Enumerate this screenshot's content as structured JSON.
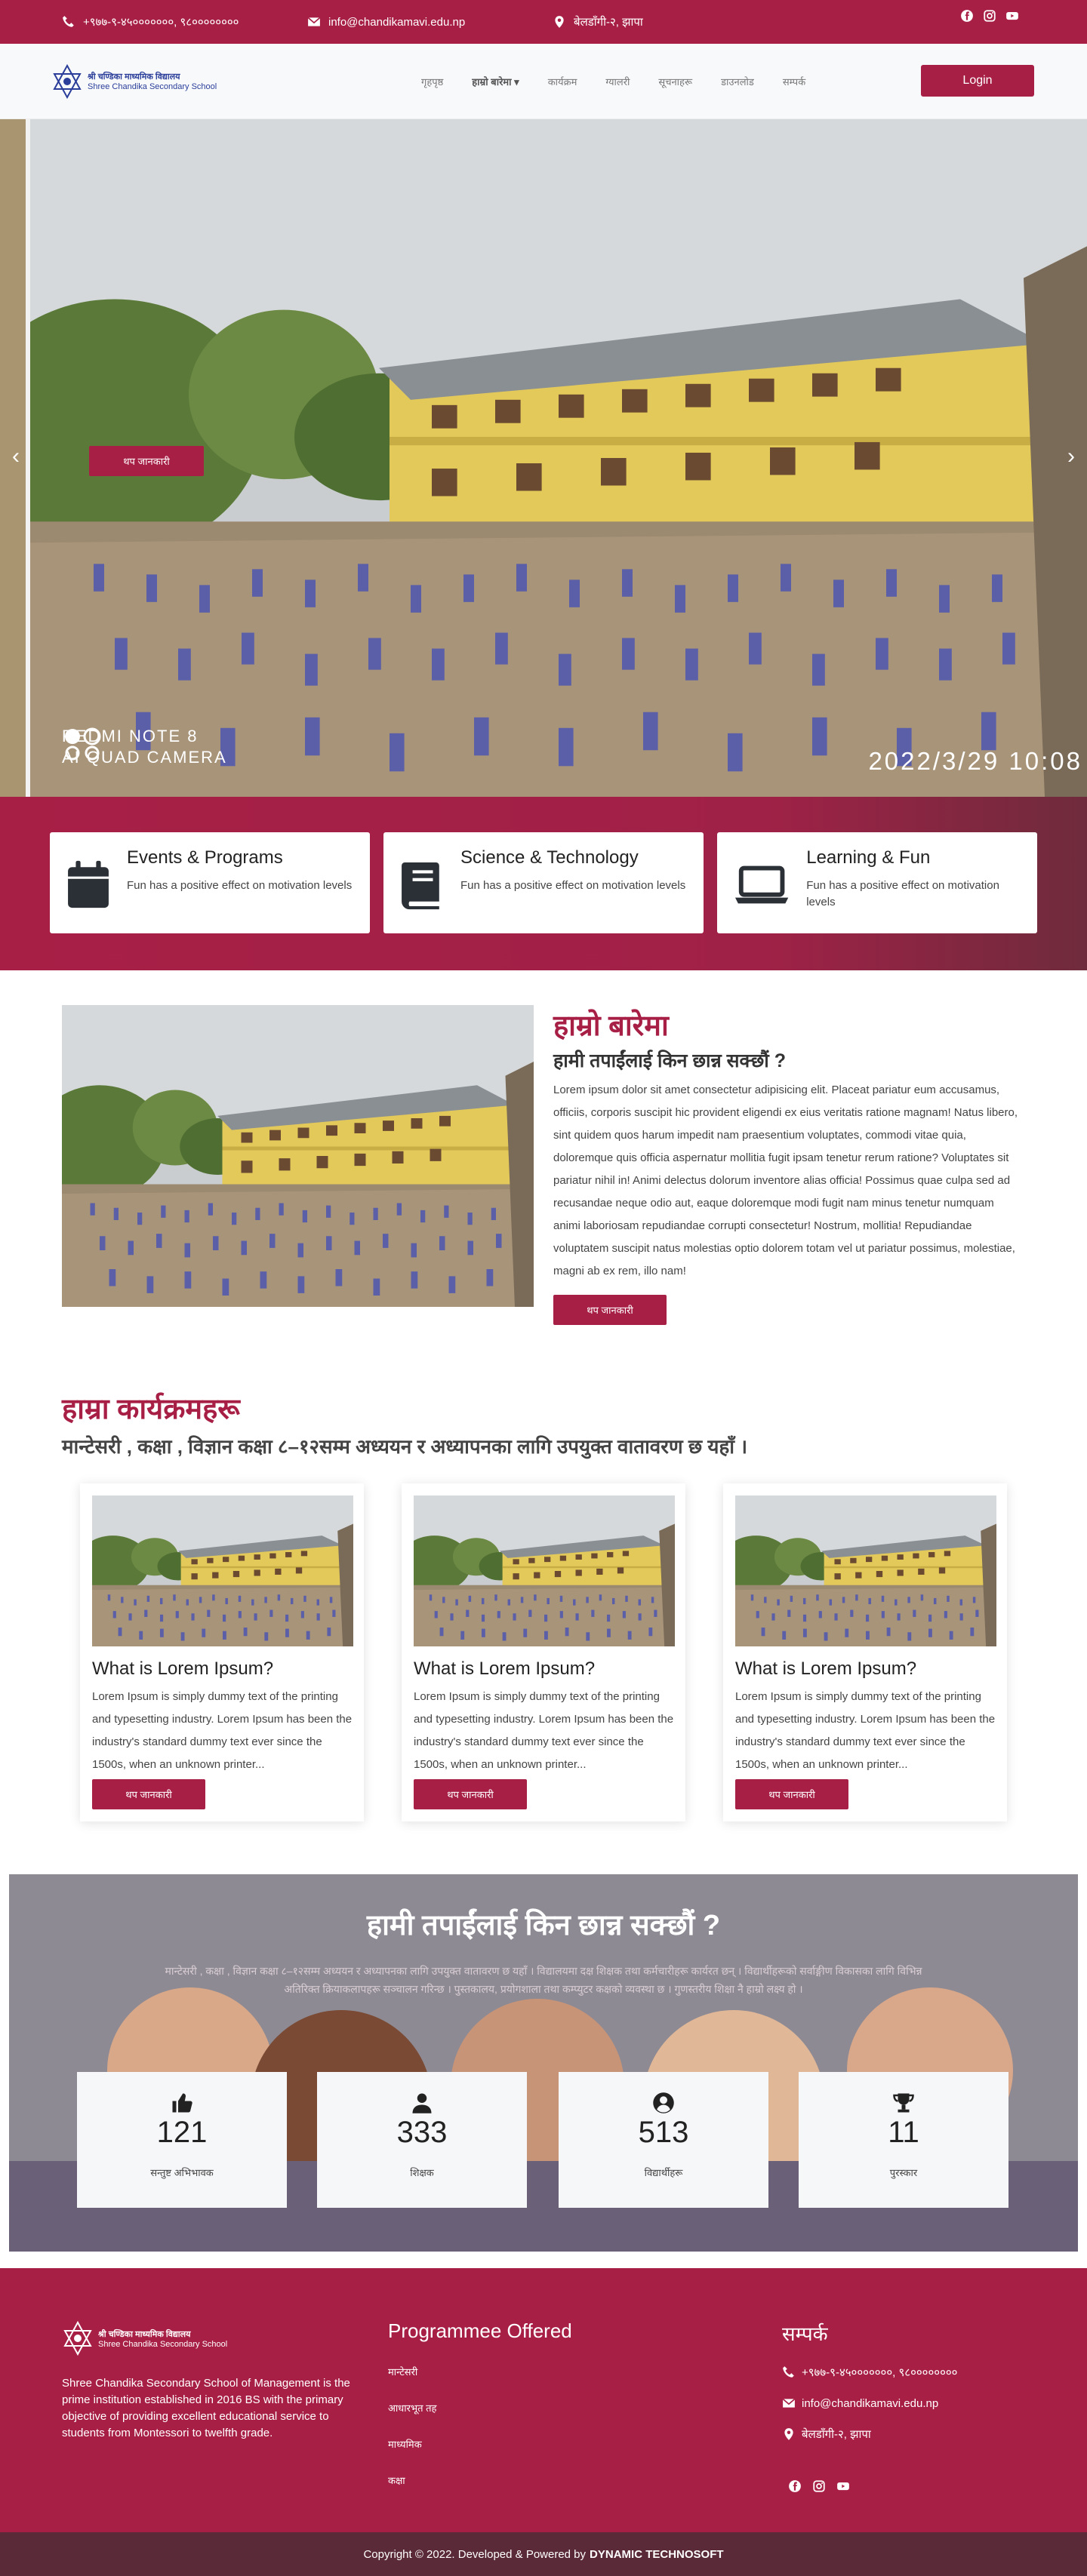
{
  "topbar": {
    "phone": "+९७७-९-४५०००००००, ९८००००००००",
    "email": "info@chandikamavi.edu.np",
    "address": "बेलडाँगी-२, झापा"
  },
  "brand": {
    "name_np": "श्री चण्डिका माध्यमिक विद्यालय",
    "name_en": "Shree Chandika Secondary School"
  },
  "nav": {
    "items": [
      "गृहपृष्ठ",
      "हाम्रो बारेमा",
      "कार्यक्रम",
      "ग्यालरी",
      "सूचनाहरू",
      "डाउनलोड",
      "सम्पर्क"
    ],
    "login": "Login"
  },
  "hero": {
    "button": "थप जानकारी",
    "watermark_line1": "REDMI NOTE 8",
    "watermark_line2": "AI QUAD CAMERA",
    "datestamp": "2022/3/29  10:08"
  },
  "features": [
    {
      "icon": "calendar-icon",
      "title": "Events & Programs",
      "text": "Fun has a positive effect on motivation levels"
    },
    {
      "icon": "book-icon",
      "title": "Science & Technology",
      "text": "Fun has a positive effect on motivation levels"
    },
    {
      "icon": "laptop-icon",
      "title": "Learning & Fun",
      "text": "Fun has a positive effect on motivation levels"
    }
  ],
  "about": {
    "title": "हाम्रो बारेमा",
    "subtitle": "हामी तपाईंलाई किन छान्न सक्छौं ?",
    "text": "Lorem ipsum dolor sit amet consectetur adipisicing elit. Placeat pariatur eum accusamus, officiis, corporis suscipit hic provident eligendi ex eius veritatis ratione magnam! Natus libero, sint quidem quos harum impedit nam praesentium voluptates, commodi vitae quia, doloremque quis officia aspernatur mollitia fugit ipsam tenetur rerum ratione? Voluptates sit pariatur nihil in! Animi delectus dolorum inventore alias officia! Possimus quae culpa sed ad recusandae neque odio aut, eaque doloremque modi fugit nam minus tenetur numquam animi laboriosam repudiandae corrupti consectetur! Nostrum, mollitia! Repudiandae voluptatem suscipit natus molestias optio dolorem totam vel ut pariatur possimus, molestiae, magni ab ex rem, illo nam!",
    "button": "थप जानकारी"
  },
  "services": {
    "title": "हाम्रा कार्यक्रमहरू",
    "subtitle": "मान्टेसरी , कक्षा , विज्ञान कक्षा ८–१२सम्म अध्ययन र अध्यापनका लागि उपयुक्त वातावरण छ यहाँ ।",
    "cards": [
      {
        "title": "What is Lorem Ipsum?",
        "text": "Lorem Ipsum is simply dummy text of the printing and typesetting industry. Lorem Ipsum has been the industry's standard dummy text ever since the 1500s, when an unknown printer...",
        "button": "थप जानकारी"
      },
      {
        "title": "What is Lorem Ipsum?",
        "text": "Lorem Ipsum is simply dummy text of the printing and typesetting industry. Lorem Ipsum has been the industry's standard dummy text ever since the 1500s, when an unknown printer...",
        "button": "थप जानकारी"
      },
      {
        "title": "What is Lorem Ipsum?",
        "text": "Lorem Ipsum is simply dummy text of the printing and typesetting industry. Lorem Ipsum has been the industry's standard dummy text ever since the 1500s, when an unknown printer...",
        "button": "थप जानकारी"
      }
    ]
  },
  "stats": {
    "title": "हामी तपाईंलाई किन छान्न सक्छौं ?",
    "text": "मान्टेसरी , कक्षा , विज्ञान कक्षा ८–१२सम्म अध्ययन र अध्यापनका लागि उपयुक्त वातावरण छ यहाँ । विद्यालयमा दक्ष शिक्षक तथा कर्मचारीहरू कार्यरत छन् । विद्यार्थीहरूको सर्वाङ्गीण विकासका लागि विभिन्न अतिरिक्त क्रियाकलापहरू सञ्चालन गरिन्छ । पुस्तकालय, प्रयोगशाला तथा कम्प्युटर कक्षको व्यवस्था छ । गुणस्तरीय शिक्षा नै हाम्रो लक्ष्य हो ।",
    "items": [
      {
        "icon": "thumbs-up-icon",
        "value": "121",
        "label": "सन्तुष्ट अभिभावक"
      },
      {
        "icon": "user-icon",
        "value": "333",
        "label": "शिक्षक"
      },
      {
        "icon": "user-circle-icon",
        "value": "513",
        "label": "विद्यार्थीहरू"
      },
      {
        "icon": "trophy-icon",
        "value": "11",
        "label": "पुरस्कार"
      }
    ]
  },
  "footer": {
    "name_np": "श्री चण्डिका माध्यमिक विद्यालय",
    "name_en": "Shree Chandika Secondary School",
    "description": "Shree Chandika Secondary School  of Management is the prime institution established in 2016 BS with the primary objective of providing excellent educational service to students from Montessori to twelfth grade.",
    "programmes_title": "Programmee Offered",
    "programmes": [
      "मान्टेसरी",
      "आधारभूत तह",
      "माध्यमिक",
      "कक्षा"
    ],
    "contact_title": "सम्पर्क",
    "phone": "+९७७-९-४५०००००००, ९८००००००००",
    "email": "info@chandikamavi.edu.np",
    "address": "बेलडाँगी-२, झापा"
  },
  "copyright": {
    "text": "Copyright © 2022. Developed & Powered by",
    "company": "DYNAMIC TECHNOSOFT"
  },
  "colors": {
    "primary": "#a81f46",
    "dark": "#5a2a38"
  }
}
